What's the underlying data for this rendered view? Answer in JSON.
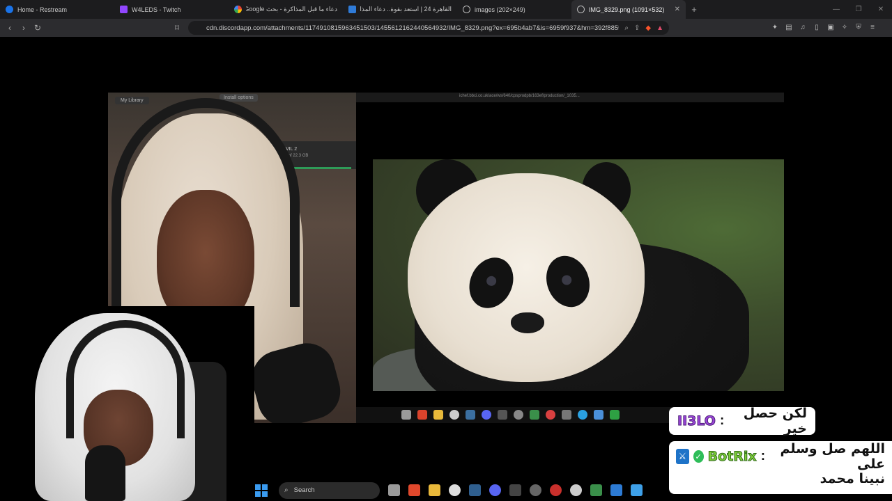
{
  "tabs": [
    {
      "label": "Home - Restream",
      "color": "#1a73e8"
    },
    {
      "label": "W4LEDS - Twitch",
      "color": "#9146ff"
    },
    {
      "label": "دعاء ما قبل المذاكرة - بحث Google",
      "color": "#ffffff"
    },
    {
      "label": "القاهرة 24 | استعد بقوة.. دعاء المذاكرة",
      "color": "#2f7bd8"
    },
    {
      "label": "images (202×249)",
      "color": "#bbbbbb"
    },
    {
      "label": "IMG_8329.png (1091×532)",
      "color": "#bbbbbb"
    }
  ],
  "address": {
    "url": "cdn.discordapp.com/attachments/1174910815963451503/1455612162440564932/IMG_8329.png?ex=695b4ab7&is=6959f937&hm=392f8855d..."
  },
  "stream": {
    "library_label": "My Library",
    "install_label": "Install options",
    "download_name": "VIL 2",
    "download_size": "21.1 GB of 22.3 GB",
    "download_progress": 0.95,
    "inner_url": "ichef.bbci.co.uk/ace/ws/640/cpsprodpb/163ef/production/_1035..."
  },
  "taskbar": {
    "search_label": "Search"
  },
  "chat": [
    {
      "user": "II3LO",
      "separator": ":",
      "message": "لكن حصل خير"
    },
    {
      "user": "BotRix",
      "separator": ":",
      "message_line1": "اللهم صل وسلم على",
      "message_line2": "نبينا محمد"
    }
  ],
  "colors": {
    "accent": "#3a9bf0",
    "user1": "#9a45d8",
    "user2": "#7fcf3a"
  }
}
